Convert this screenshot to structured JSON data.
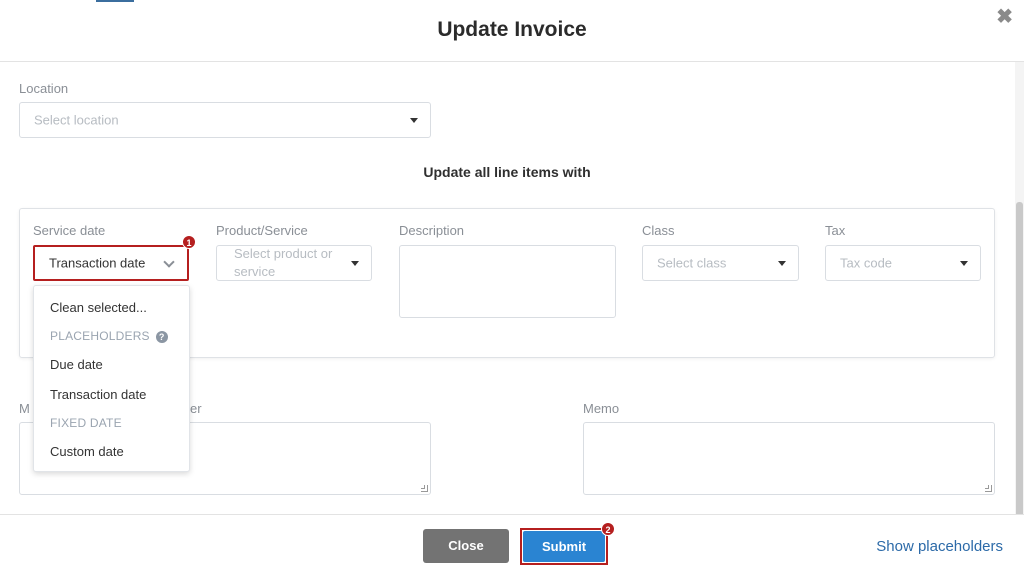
{
  "modal": {
    "title": "Update Invoice",
    "close_glyph": "✖"
  },
  "location": {
    "label": "Location",
    "placeholder": "Select location"
  },
  "line_items": {
    "section_title": "Update all line items with",
    "service_date": {
      "label": "Service date",
      "value": "Transaction date",
      "badge": "1"
    },
    "product_service": {
      "label": "Product/Service",
      "placeholder": "Select product or service"
    },
    "description": {
      "label": "Description"
    },
    "class": {
      "label": "Class",
      "placeholder": "Select class"
    },
    "tax": {
      "label": "Tax",
      "placeholder": "Tax code"
    }
  },
  "dropdown": {
    "clean": "Clean selected...",
    "group_placeholders": "PLACEHOLDERS",
    "help_glyph": "?",
    "due_date": "Due date",
    "transaction_date": "Transaction date",
    "group_fixed": "FIXED DATE",
    "custom_date": "Custom date"
  },
  "message": {
    "label_left": "M",
    "label_right": "er"
  },
  "memo": {
    "label": "Memo"
  },
  "footer": {
    "close_label": "Close",
    "submit_label": "Submit",
    "submit_badge": "2",
    "show_placeholders": "Show placeholders"
  },
  "colors": {
    "accent_blue": "#2a84d2",
    "highlight_red": "#b51f1f",
    "link_blue": "#2c6aa8"
  }
}
